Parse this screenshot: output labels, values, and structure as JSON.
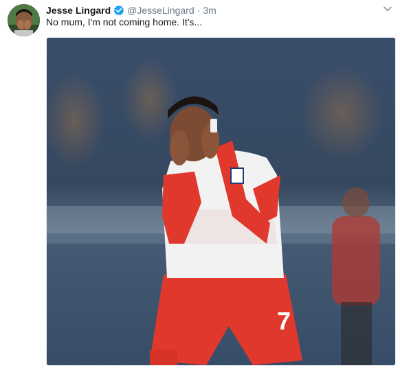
{
  "tweet": {
    "display_name": "Jesse Lingard",
    "handle": "@JesseLingard",
    "separator": "·",
    "timestamp": "3m",
    "text": "No mum, I'm not coming home. It's...",
    "verified_icon": "verified-badge-icon",
    "menu_icon": "chevron-down-icon",
    "avatar": "profile-photo",
    "media": "photo-player-hands-on-face"
  },
  "colors": {
    "accent": "#1da1f2",
    "secondary_text": "#657786",
    "primary_text": "#14171a",
    "jersey_white": "#f2f2f2",
    "shorts_red": "#e0382c"
  }
}
